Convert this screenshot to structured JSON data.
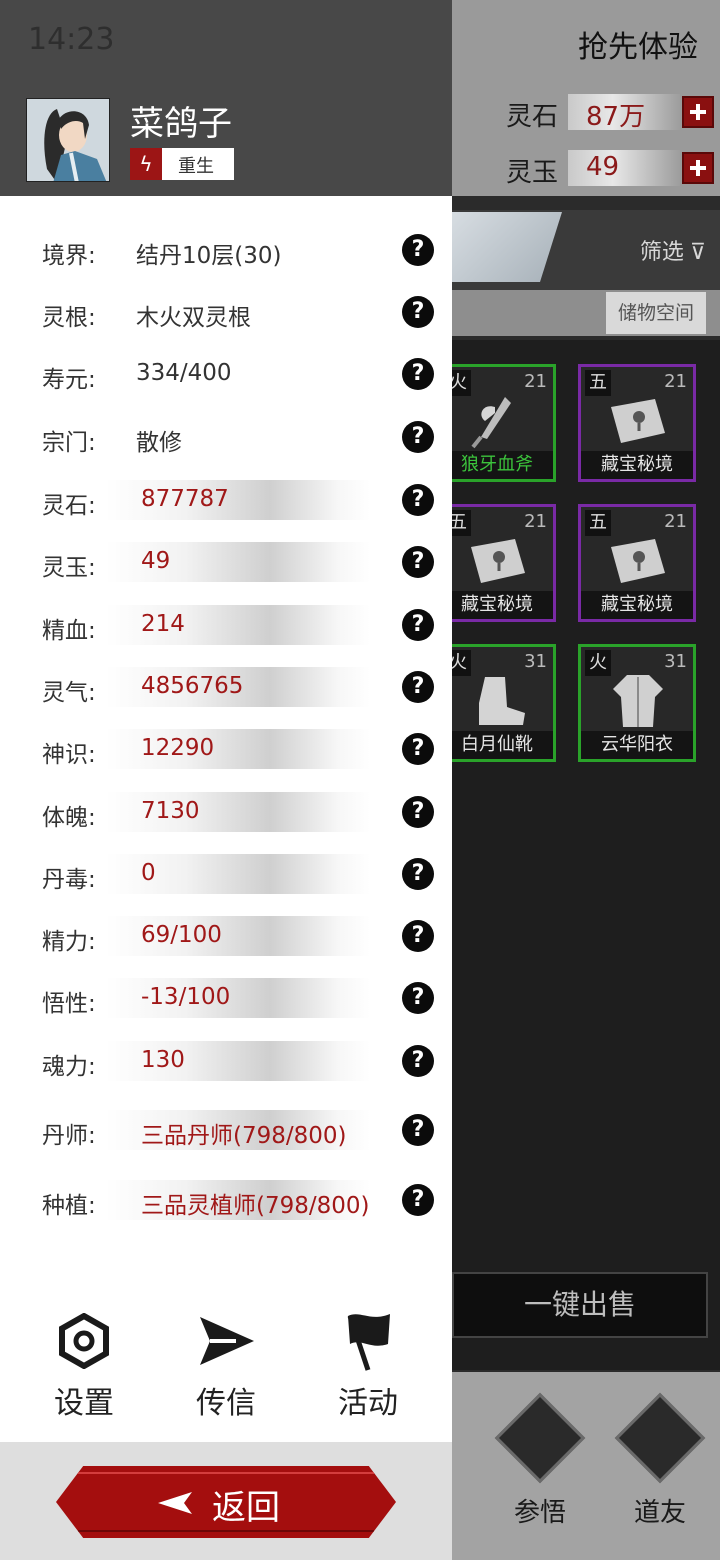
{
  "status_bar": {
    "time": "14:23"
  },
  "background": {
    "title": "抢先体验",
    "resources": [
      {
        "label": "灵石",
        "value": "87万"
      },
      {
        "label": "灵玉",
        "value": "49"
      }
    ],
    "filter_label": "筛选",
    "storage_label": "储物空间",
    "items": [
      {
        "element": "火",
        "level": "21",
        "name": "狼牙血斧",
        "rarity": "green",
        "icon": "axe-icon"
      },
      {
        "element": "五",
        "level": "21",
        "name": "藏宝秘境",
        "rarity": "purple",
        "icon": "treasure-map-icon"
      },
      {
        "element": "五",
        "level": "21",
        "name": "藏宝秘境",
        "rarity": "purple",
        "icon": "treasure-map-icon"
      },
      {
        "element": "五",
        "level": "21",
        "name": "藏宝秘境",
        "rarity": "purple",
        "icon": "treasure-map-icon"
      },
      {
        "element": "火",
        "level": "31",
        "name": "白月仙靴",
        "rarity": "green",
        "icon": "boots-icon"
      },
      {
        "element": "火",
        "level": "31",
        "name": "云华阳衣",
        "rarity": "green",
        "icon": "robe-icon"
      }
    ],
    "sell_all_label": "一键出售",
    "nav": [
      {
        "label": "参悟"
      },
      {
        "label": "道友"
      }
    ]
  },
  "profile": {
    "name": "菜鸽子",
    "tag": "重生"
  },
  "stats": [
    {
      "label": "境界:",
      "value": "结丹10层(30)",
      "style": "plain"
    },
    {
      "label": "灵根:",
      "value": "木火双灵根",
      "style": "plain"
    },
    {
      "label": "寿元:",
      "value": "334/400",
      "style": "plain"
    },
    {
      "label": "宗门:",
      "value": "散修",
      "style": "plain"
    },
    {
      "label": "灵石:",
      "value": "877787",
      "style": "bar"
    },
    {
      "label": "灵玉:",
      "value": "49",
      "style": "bar"
    },
    {
      "label": "精血:",
      "value": "214",
      "style": "bar"
    },
    {
      "label": "灵气:",
      "value": "4856765",
      "style": "bar"
    },
    {
      "label": "神识:",
      "value": "12290",
      "style": "bar"
    },
    {
      "label": "体魄:",
      "value": "7130",
      "style": "bar"
    },
    {
      "label": "丹毒:",
      "value": "0",
      "style": "bar"
    },
    {
      "label": "精力:",
      "value": "69/100",
      "style": "bar"
    },
    {
      "label": "悟性:",
      "value": "-13/100",
      "style": "bar"
    },
    {
      "label": "魂力:",
      "value": "130",
      "style": "bar"
    },
    {
      "label": "丹师:",
      "value": "三品丹师(798/800)",
      "style": "bar"
    },
    {
      "label": "种植:",
      "value": "三品灵植师(798/800)",
      "style": "bar"
    }
  ],
  "help_glyph": "?",
  "panel_buttons": [
    {
      "label": "设置",
      "icon": "settings-icon"
    },
    {
      "label": "传信",
      "icon": "send-icon"
    },
    {
      "label": "活动",
      "icon": "flag-icon"
    }
  ],
  "back_label": "返回",
  "colors": {
    "accent_red": "#a40e0e",
    "value_red": "#a01818",
    "rare_green": "#2aa32a",
    "epic_purple": "#7a2aa6"
  }
}
